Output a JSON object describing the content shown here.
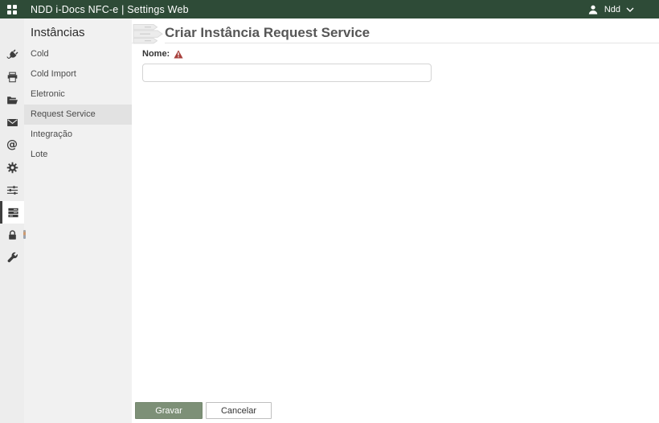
{
  "topbar": {
    "app_title": "NDD i-Docs NFC-e | Settings Web",
    "user_name": "Ndd"
  },
  "icon_rail": {
    "at_sign_glyph": "@",
    "items": [
      {
        "icon": "plug-icon",
        "selected": false
      },
      {
        "icon": "printer-icon",
        "selected": false
      },
      {
        "icon": "folder-open-icon",
        "selected": false
      },
      {
        "icon": "mail-icon",
        "selected": false
      },
      {
        "icon": "at-sign-icon",
        "selected": false
      },
      {
        "icon": "gear-icon",
        "selected": false
      },
      {
        "icon": "sliders-icon",
        "selected": false
      },
      {
        "icon": "instances-icon",
        "selected": true
      },
      {
        "icon": "lock-icon",
        "selected": false
      },
      {
        "icon": "wrench-icon",
        "selected": false
      }
    ]
  },
  "sidebar": {
    "heading": "Instâncias",
    "items": [
      {
        "label": "Cold",
        "selected": false
      },
      {
        "label": "Cold Import",
        "selected": false
      },
      {
        "label": "Eletronic",
        "selected": false
      },
      {
        "label": "Request Service",
        "selected": true
      },
      {
        "label": "Integração",
        "selected": false
      },
      {
        "label": "Lote",
        "selected": false
      }
    ]
  },
  "main": {
    "title": "Criar Instância Request Service",
    "form": {
      "name_label": "Nome:",
      "name_value": "",
      "name_required": true
    },
    "actions": {
      "save_label": "Gravar",
      "cancel_label": "Cancelar"
    }
  },
  "colors": {
    "topbar_bg": "#2e4b37",
    "save_button_bg": "#7d9077",
    "warning_red": "#a8403c",
    "sidebar_bg": "#f1f1f1",
    "selected_item_bg": "#e2e2e2"
  }
}
